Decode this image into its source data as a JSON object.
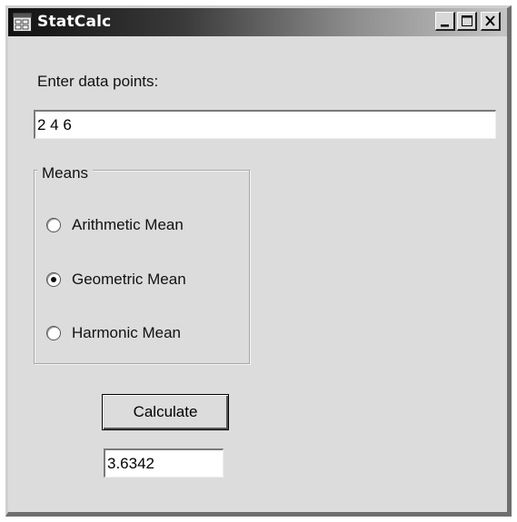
{
  "window": {
    "title": "StatCalc",
    "controls": [
      "minimize-icon",
      "maximize-icon",
      "close-icon"
    ]
  },
  "form": {
    "data_label": "Enter data points:",
    "data_value": "2 4 6",
    "means_group": {
      "title": "Means",
      "options": [
        {
          "label": "Arithmetic Mean",
          "selected": false
        },
        {
          "label": "Geometric Mean",
          "selected": true
        },
        {
          "label": "Harmonic Mean",
          "selected": false
        }
      ]
    },
    "calculate_label": "Calculate",
    "result_value": "3.6342"
  }
}
